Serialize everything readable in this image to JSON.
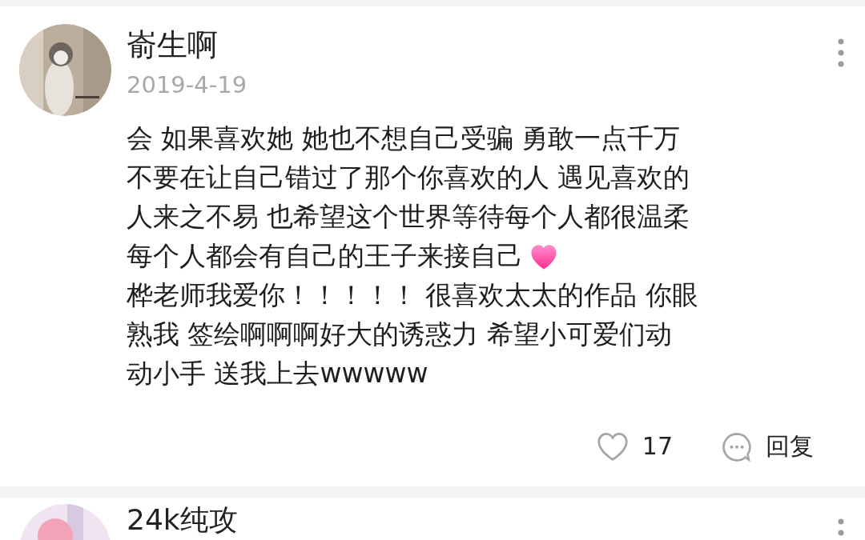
{
  "comments": [
    {
      "name": "嵛生啊",
      "date": "2019-4-19",
      "paragraphs": [
        [
          "会 如果喜欢她 她也不想自己受骗 勇敢一点千万",
          "不要在让自己错过了那个你喜欢的人 遇见喜欢的",
          "人来之不易 也希望这个世界等待每个人都很温柔",
          "每个人都会有自己的王子来接自己"
        ],
        [
          "桦老师我爱你！！！！！ 很喜欢太太的作品 你眼",
          "熟我 签绘啊啊啊好大的诱惑力 希望小可爱们动",
          "动小手 送我上去wwwww"
        ]
      ],
      "likes": "17",
      "reply": "回复"
    },
    {
      "name": "24k纯攻"
    }
  ]
}
